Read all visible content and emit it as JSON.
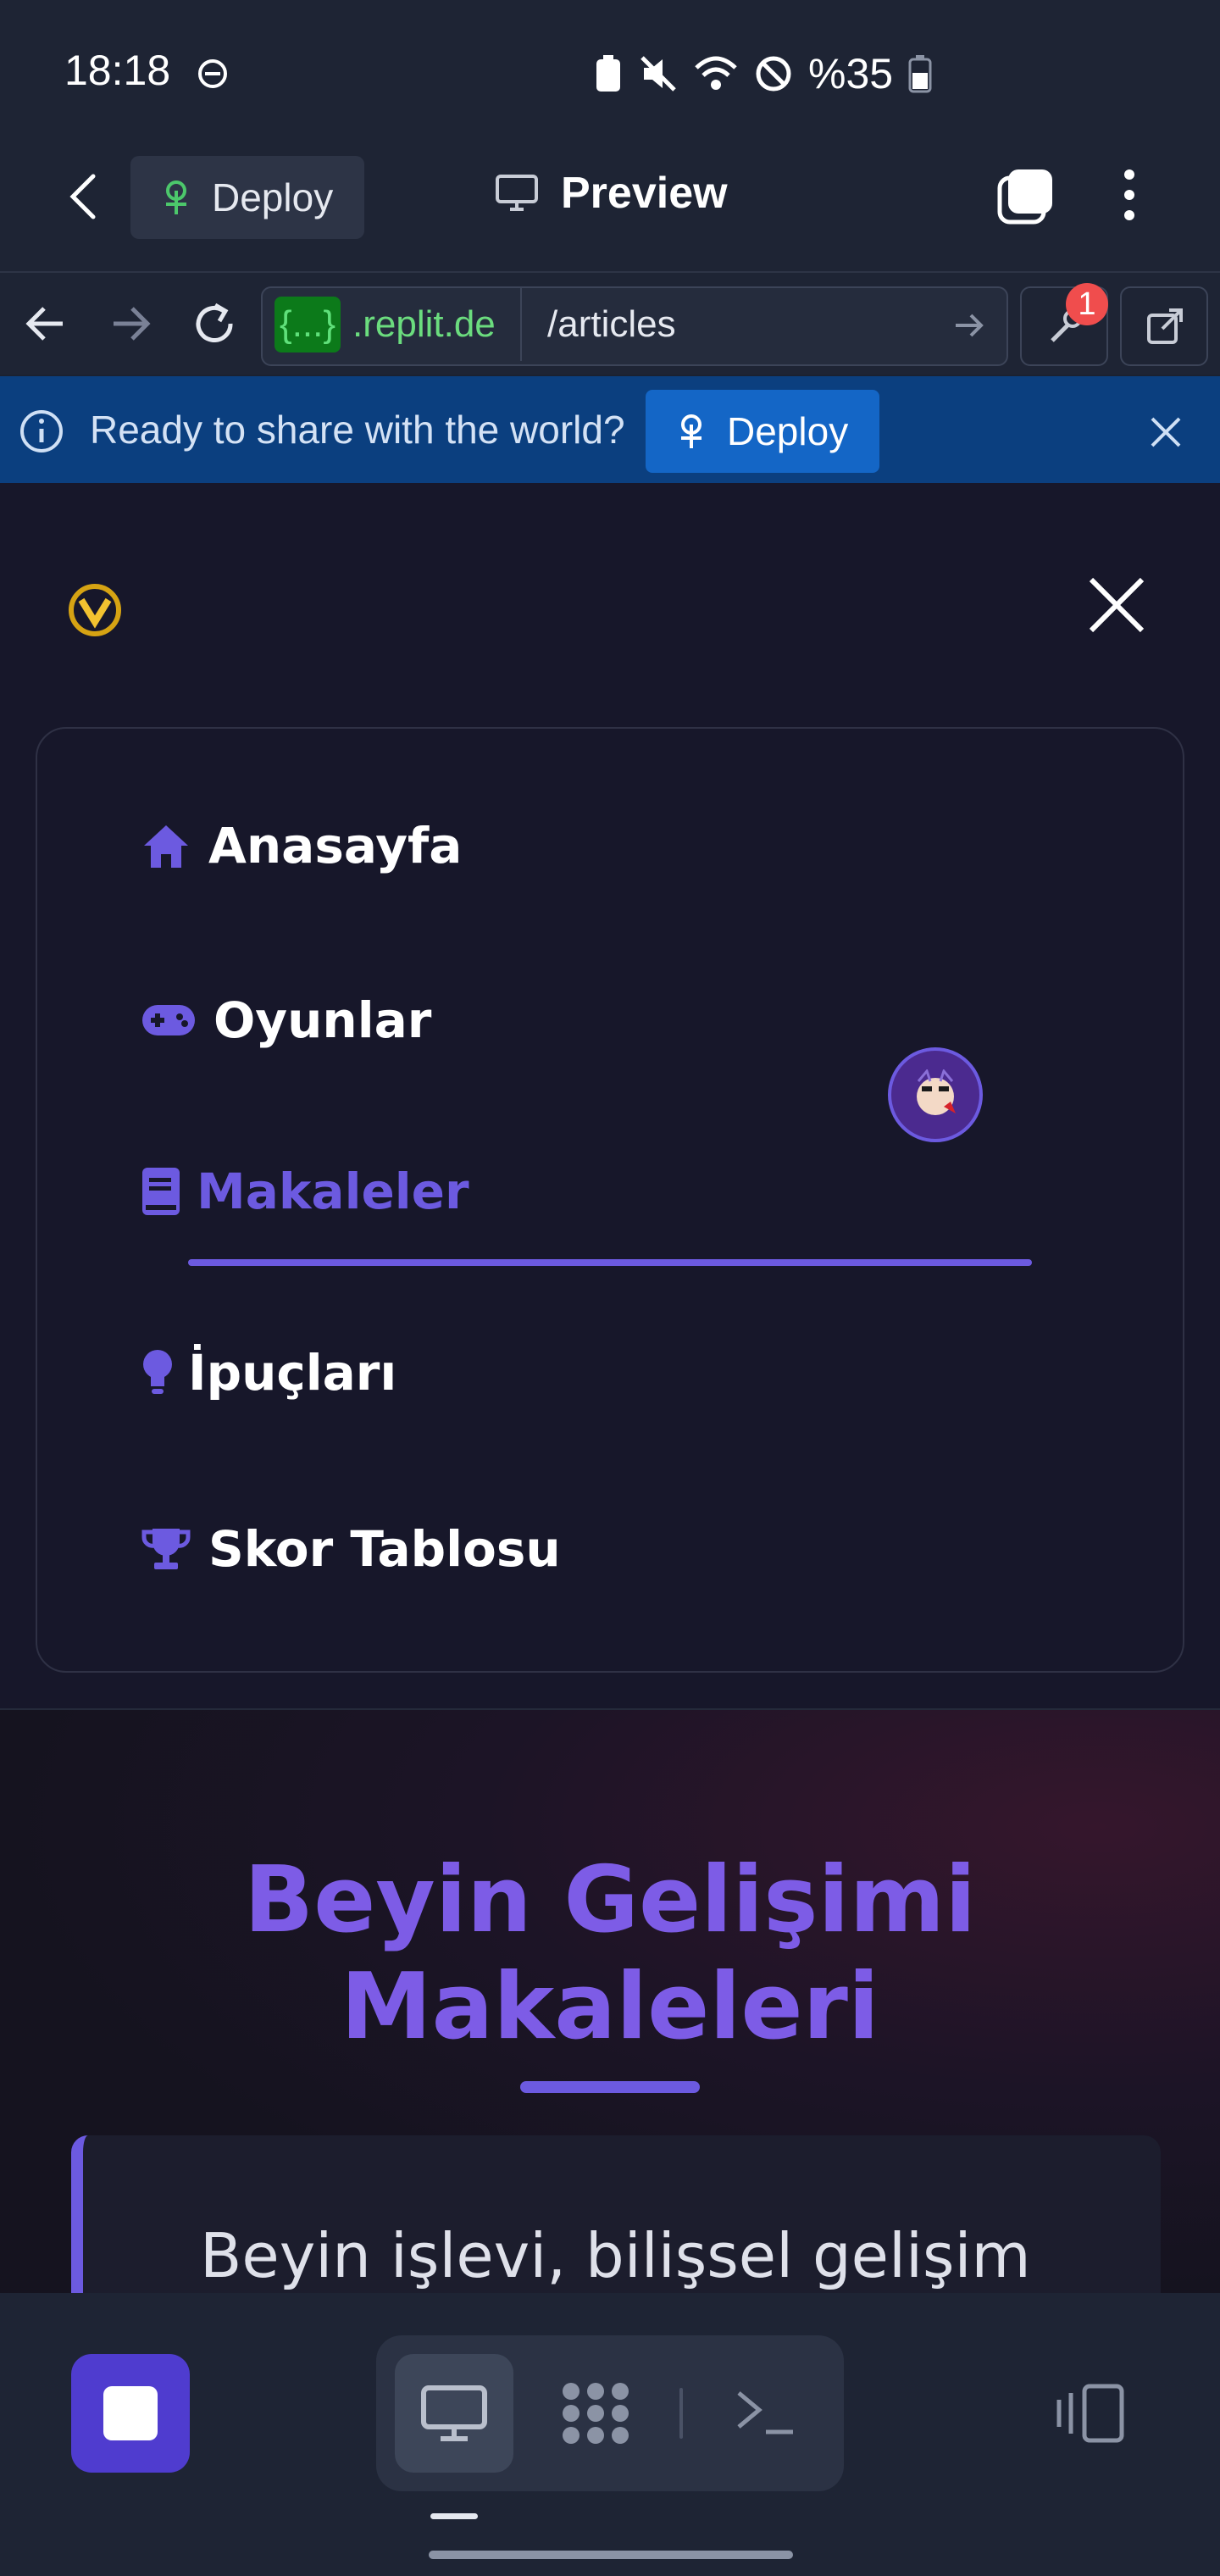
{
  "status_bar": {
    "time": "18:18",
    "battery": "%35"
  },
  "header": {
    "deploy_label": "Deploy",
    "preview_label": "Preview"
  },
  "url_bar": {
    "host_token": "{...}",
    "host_rest": ".replit.de",
    "path": "/articles",
    "badge_count": "1"
  },
  "banner": {
    "message": "Ready to share with the world?",
    "button_label": "Deploy"
  },
  "nav": {
    "items": [
      {
        "label": "Anasayfa",
        "icon": "home-icon",
        "active": false
      },
      {
        "label": "Oyunlar",
        "icon": "gamepad-icon",
        "active": false
      },
      {
        "label": "Makaleler",
        "icon": "book-icon",
        "active": true
      },
      {
        "label": "İpuçları",
        "icon": "lightbulb-icon",
        "active": false
      },
      {
        "label": "Skor Tablosu",
        "icon": "trophy-icon",
        "active": false
      }
    ]
  },
  "hero": {
    "title_line1": "Beyin Gelişimi",
    "title_line2": "Makaleleri",
    "intro_text": "Beyin işlevi, bilişsel gelişim"
  },
  "colors": {
    "accent": "#6c5ae0",
    "banner": "#0b3f7f",
    "deploy_button": "#1466c6",
    "page_bg": "#17172a"
  }
}
